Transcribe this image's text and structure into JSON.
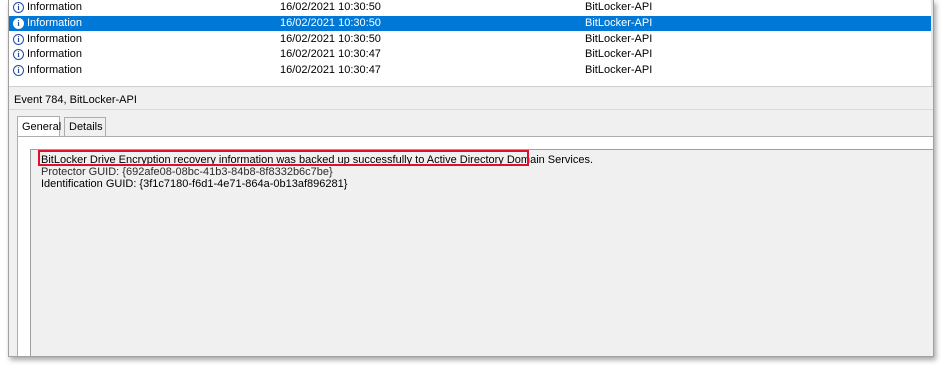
{
  "event_list": {
    "rows": [
      {
        "level": "Information",
        "date": "16/02/2021 10:30:50",
        "source": "BitLocker-API",
        "selected": false
      },
      {
        "level": "Information",
        "date": "16/02/2021 10:30:50",
        "source": "BitLocker-API",
        "selected": true
      },
      {
        "level": "Information",
        "date": "16/02/2021 10:30:50",
        "source": "BitLocker-API",
        "selected": false
      },
      {
        "level": "Information",
        "date": "16/02/2021 10:30:47",
        "source": "BitLocker-API",
        "selected": false
      },
      {
        "level": "Information",
        "date": "16/02/2021 10:30:47",
        "source": "BitLocker-API",
        "selected": false
      }
    ],
    "selection_color": "#0078d7",
    "info_icon": "info-circle-icon"
  },
  "detail": {
    "header": "Event 784, BitLocker-API",
    "tabs": [
      {
        "label": "General",
        "active": true
      },
      {
        "label": "Details",
        "active": false
      }
    ],
    "message": {
      "line1": "BitLocker Drive Encryption recovery information was backed up successfully to Active Directory Domain Services.",
      "line2": "Protector GUID: {692afe08-08bc-41b3-84b8-8f8332b6c7be}",
      "line3": "Identification GUID: {3f1c7180-f6d1-4e71-864a-0b13af896281}"
    },
    "highlight_color": "#e0102c"
  }
}
